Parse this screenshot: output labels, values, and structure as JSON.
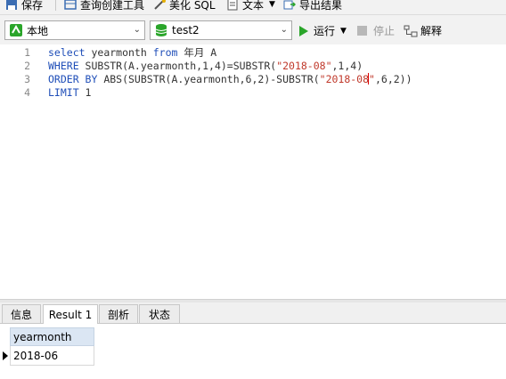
{
  "toolbar": {
    "save_label": "保存",
    "query_builder_label": "查询创建工具",
    "beautify_label": "美化 SQL",
    "text_label": "文本",
    "export_label": "导出结果"
  },
  "connection_bar": {
    "connection_value": "本地",
    "database_value": "test2",
    "run_label": "运行",
    "stop_label": "停止",
    "explain_label": "解释"
  },
  "editor": {
    "line_numbers": [
      "1",
      "2",
      "3",
      "4"
    ],
    "line1": {
      "kw1": "select",
      "t1": " yearmonth ",
      "kw2": "from",
      "t2": " 年月 A"
    },
    "line2": {
      "kw1": "WHERE",
      "t1": " SUBSTR(A.yearmonth,1,4)=SUBSTR(",
      "s1": "\"2018-08\"",
      "t2": ",1,4)"
    },
    "line3": {
      "kw1": "ORDER BY",
      "t1": " ABS(SUBSTR(A.yearmonth,6,2)-SUBSTR(",
      "s1a": "\"2018-08",
      "s1b": "\"",
      "t2": ",6,2))"
    },
    "line4": {
      "kw1": "LIMIT",
      "t1": " 1"
    }
  },
  "tabs": [
    "信息",
    "Result 1",
    "剖析",
    "状态"
  ],
  "result": {
    "columns": [
      "yearmonth"
    ],
    "rows": [
      [
        "2018-06"
      ]
    ]
  },
  "colors": {
    "keyword": "#1f4eb8",
    "string": "#c0392b",
    "header_bg": "#dbe6f3",
    "run_green": "#2aa52a"
  }
}
